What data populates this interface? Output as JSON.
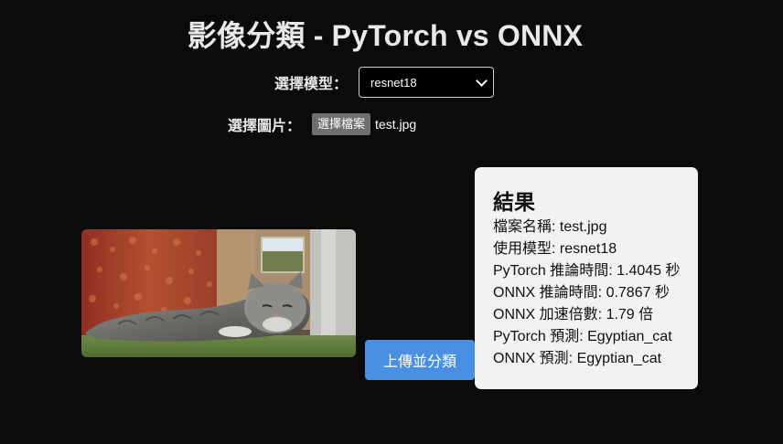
{
  "page": {
    "title": "影像分類 - PyTorch vs ONNX"
  },
  "model": {
    "label": "選擇模型：",
    "selected": "resnet18"
  },
  "file": {
    "label": "選擇圖片：",
    "button_label": "選擇檔案",
    "filename": "test.jpg"
  },
  "preview": {
    "icon": "cat-photo-preview"
  },
  "upload": {
    "label": "上傳並分類",
    "color": "#4a90e2"
  },
  "result": {
    "heading": "結果",
    "lines": [
      "檔案名稱: test.jpg",
      "使用模型: resnet18",
      "PyTorch 推論時間: 1.4045 秒",
      "ONNX 推論時間: 0.7867 秒",
      "ONNX 加速倍數: 1.79 倍",
      "PyTorch 預測: Egyptian_cat",
      "ONNX 預測: Egyptian_cat"
    ]
  }
}
